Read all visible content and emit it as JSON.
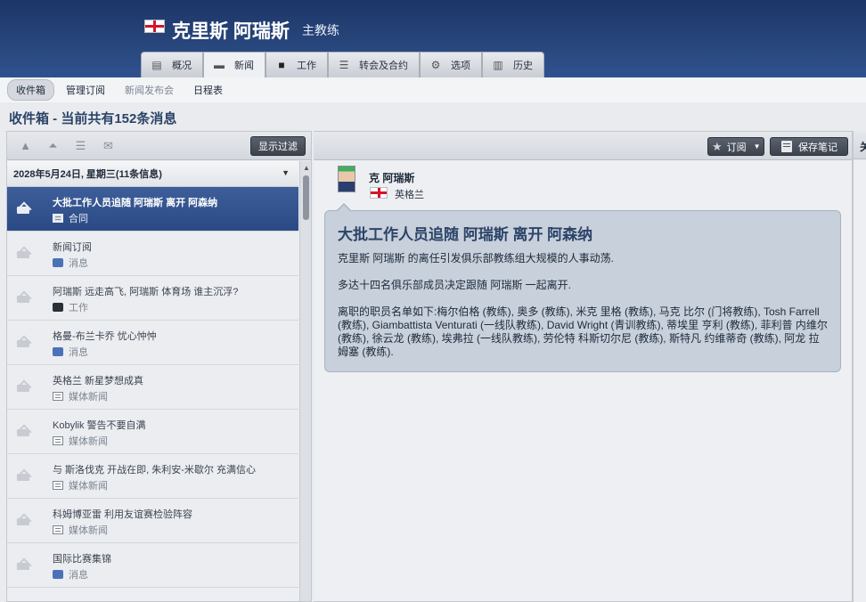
{
  "header": {
    "manager_name": "克里斯 阿瑞斯",
    "role": "主教练",
    "tabs": [
      {
        "label": "概况",
        "icon": "profile-card-icon"
      },
      {
        "label": "新闻",
        "icon": "newspaper-icon"
      },
      {
        "label": "工作",
        "icon": "briefcase-icon"
      },
      {
        "label": "转会及合约",
        "icon": "contract-icon"
      },
      {
        "label": "选项",
        "icon": "gear-icon"
      },
      {
        "label": "历史",
        "icon": "history-icon"
      }
    ],
    "active_tab": "新闻"
  },
  "subnav": {
    "items": [
      "收件箱",
      "管理订阅",
      "新闻发布会",
      "日程表"
    ],
    "active": "收件箱"
  },
  "page_title": "收件箱 - 当前共有152条消息",
  "inbox": {
    "filter_button": "显示过滤",
    "date_header": "2028年5月24日, 星期三(11条信息)",
    "messages": [
      {
        "title": "大批工作人员追随 阿瑞斯  离开 阿森纳",
        "category": "合同",
        "cat_icon": "news"
      },
      {
        "title": "新闻订阅",
        "category": "消息",
        "cat_icon": "msgbub"
      },
      {
        "title": "阿瑞斯  远走高飞, 阿瑞斯  体育场 谁主沉浮?",
        "category": "工作",
        "cat_icon": "work"
      },
      {
        "title": "格曼-布兰卡乔 忧心忡忡",
        "category": "消息",
        "cat_icon": "msgbub"
      },
      {
        "title": "英格兰 新星梦想成真",
        "category": "媒体新闻",
        "cat_icon": "news"
      },
      {
        "title": "Kobylik 警告不要自满",
        "category": "媒体新闻",
        "cat_icon": "news"
      },
      {
        "title": "与 斯洛伐克 开战在即, 朱利安-米歇尔 充满信心",
        "category": "媒体新闻",
        "cat_icon": "news"
      },
      {
        "title": "科姆博亚雷 利用友谊赛检验阵容",
        "category": "媒体新闻",
        "cat_icon": "news"
      },
      {
        "title": "国际比赛集锦",
        "category": "消息",
        "cat_icon": "msgbub"
      }
    ]
  },
  "message": {
    "subscribe_button": "订阅",
    "save_button": "保存笔记",
    "sender_name": "克 阿瑞斯",
    "sender_nation": "英格兰",
    "title": "大批工作人员追随 阿瑞斯  离开 阿森纳",
    "paragraphs": [
      "克里斯 阿瑞斯  的离任引发俱乐部教练组大规模的人事动荡.",
      "多达十四名俱乐部成员决定跟随 阿瑞斯  一起离开.",
      "离职的职员名单如下:梅尔伯格 (教练), 奥多 (教练), 米克 里格 (教练), 马克 比尔 (门将教练), Tosh Farrell (教练), Giambattista Venturati (一线队教练), David Wright (青训教练), 蒂埃里 亨利 (教练), 菲利普 内维尔 (教练), 徐云龙 (教练), 埃弗拉 (一线队教练), 劳伦特 科斯切尔尼 (教练), 斯特凡 约维蒂奇 (教练), 阿龙 拉姆塞 (教练)."
    ]
  },
  "right_pane": {
    "header_fragment": "关"
  }
}
